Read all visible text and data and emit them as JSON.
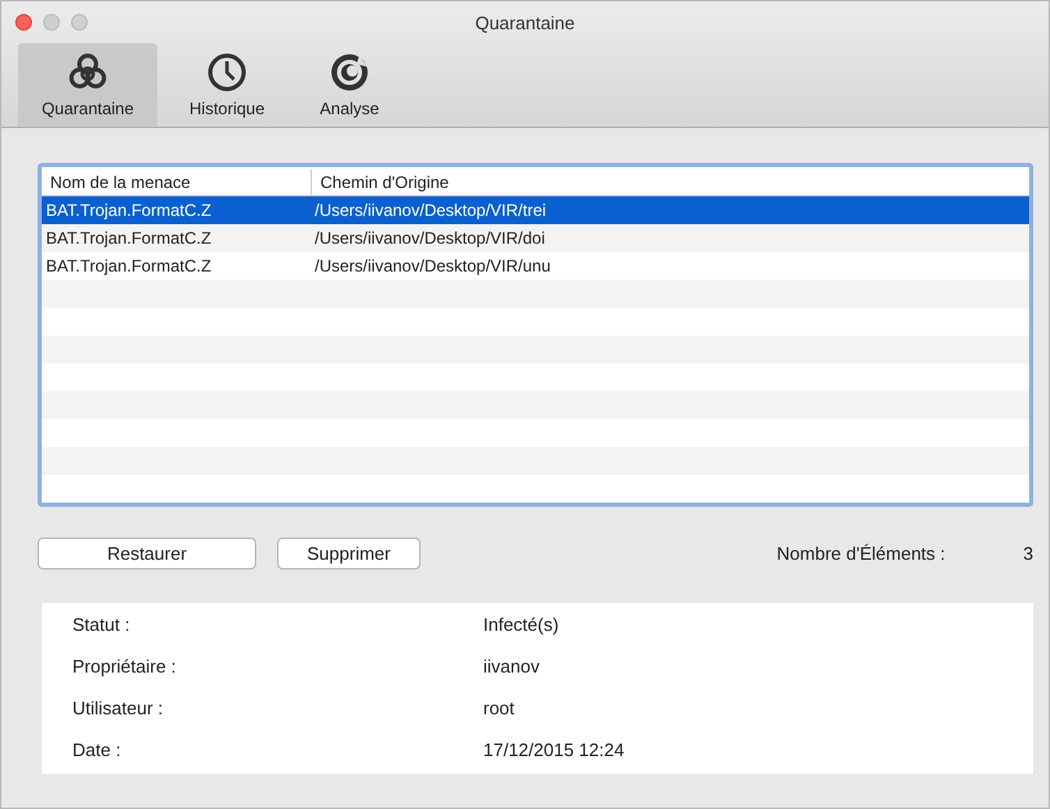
{
  "window": {
    "title": "Quarantaine"
  },
  "tabs": [
    {
      "label": "Quarantaine",
      "selected": true
    },
    {
      "label": "Historique",
      "selected": false
    },
    {
      "label": "Analyse",
      "selected": false
    }
  ],
  "table": {
    "columns": [
      "Nom de la menace",
      "Chemin d'Origine"
    ],
    "rows": [
      {
        "cells": [
          "BAT.Trojan.FormatC.Z",
          "/Users/iivanov/Desktop/VIR/trei"
        ],
        "selected": true
      },
      {
        "cells": [
          "BAT.Trojan.FormatC.Z",
          "/Users/iivanov/Desktop/VIR/doi"
        ],
        "selected": false
      },
      {
        "cells": [
          "BAT.Trojan.FormatC.Z",
          "/Users/iivanov/Desktop/VIR/unu"
        ],
        "selected": false
      }
    ]
  },
  "buttons": [
    "Restaurer",
    "Supprimer"
  ],
  "count": {
    "label": "Nombre d'Éléments :",
    "value": "3"
  },
  "details": [
    {
      "label": "Statut :",
      "value": "Infecté(s)"
    },
    {
      "label": "Propriétaire :",
      "value": "iivanov"
    },
    {
      "label": "Utilisateur :",
      "value": "root"
    },
    {
      "label": "Date :",
      "value": "17/12/2015 12:24"
    }
  ]
}
